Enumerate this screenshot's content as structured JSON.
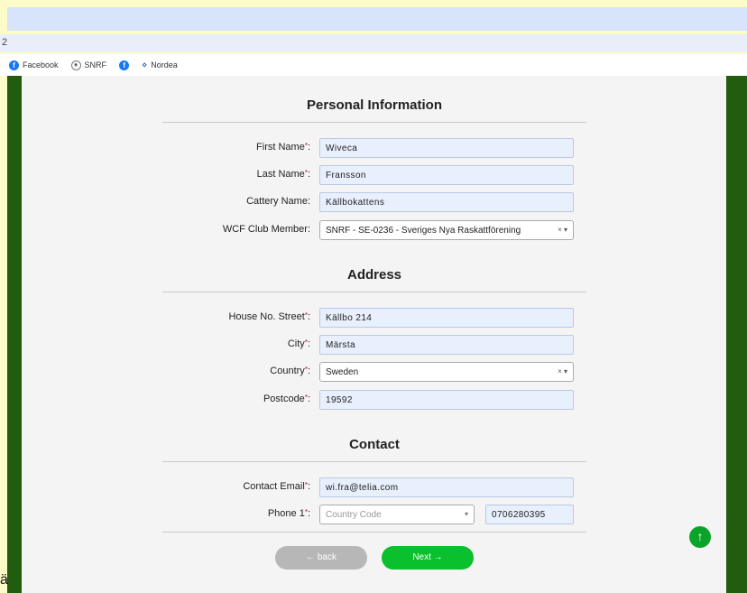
{
  "browser": {
    "tab_fragment": "2",
    "bookmarks": [
      {
        "label": "Facebook",
        "icon": "facebook-icon"
      },
      {
        "label": "SNRF",
        "icon": "snrf-icon"
      },
      {
        "label": "",
        "icon": "facebook-icon"
      },
      {
        "label": "Nordea",
        "icon": "nordea-icon"
      }
    ]
  },
  "stray_text": "ä",
  "sections": {
    "personal": "Personal Information",
    "address": "Address",
    "contact": "Contact"
  },
  "required_marker": "*",
  "label_suffix": ":",
  "fields": {
    "first_name": {
      "label": "First Name",
      "value": "Wiveca"
    },
    "last_name": {
      "label": "Last Name",
      "value": "Fransson"
    },
    "cattery_name": {
      "label": "Cattery Name",
      "value": "Källbokattens"
    },
    "club_member": {
      "label": "WCF Club Member",
      "value": "SNRF - SE-0236 - Sveriges Nya Raskattförening"
    },
    "house_street": {
      "label": "House No. Street",
      "value": "Källbo 214"
    },
    "city": {
      "label": "City",
      "value": "Märsta"
    },
    "country": {
      "label": "Country",
      "value": "Sweden"
    },
    "postcode": {
      "label": "Postcode",
      "value": "19592"
    },
    "email": {
      "label": "Contact Email",
      "value": "wi.fra@telia.com"
    },
    "phone1": {
      "label": "Phone 1",
      "country_code_placeholder": "Country Code",
      "value": "0706280395"
    }
  },
  "select_controls": {
    "clear": "×",
    "arrow": "▾"
  },
  "buttons": {
    "back": "← back",
    "next": "Next →",
    "scroll_top": "↑"
  },
  "colors": {
    "frame_green": "#215c0f",
    "next_green": "#0ac02c",
    "back_gray": "#b7b7b7",
    "field_blue": "#e8effd",
    "required_red": "#d0021b"
  }
}
